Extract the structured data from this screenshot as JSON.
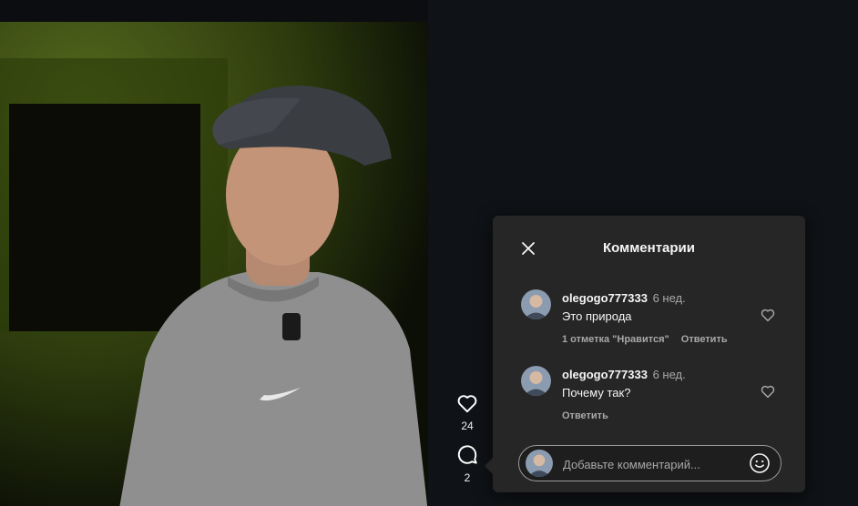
{
  "actions": {
    "likes_count": "24",
    "comments_count": "2"
  },
  "comments_panel": {
    "title": "Комментарии",
    "comments": [
      {
        "username": "olegogo777333",
        "time": "6 нед.",
        "text": "Это природа",
        "likes_label": "1 отметка \"Нравится\"",
        "reply_label": "Ответить"
      },
      {
        "username": "olegogo777333",
        "time": "6 нед.",
        "text": "Почему так?",
        "reply_label": "Ответить"
      }
    ],
    "input": {
      "placeholder": "Добавьте комментарий..."
    }
  },
  "colors": {
    "panel_bg": "#262626",
    "page_bg": "#0f1216",
    "muted_text": "#a8a8a8"
  }
}
